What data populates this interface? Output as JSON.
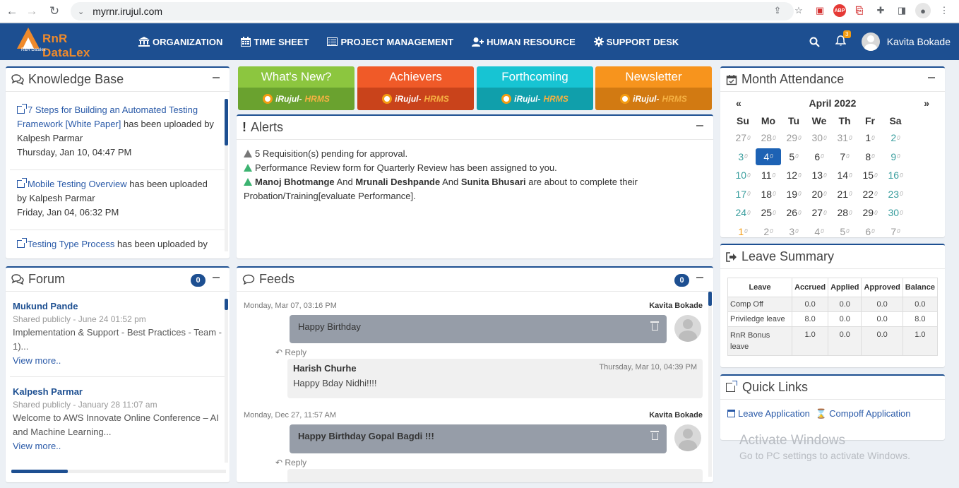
{
  "browser": {
    "url": "myrnr.irujul.com"
  },
  "header": {
    "brand": "RnR DataLex",
    "brand_sub": "R&R Datalex",
    "menu": [
      "ORGANIZATION",
      "TIME SHEET",
      "PROJECT MANAGEMENT",
      "HUMAN RESOURCE",
      "SUPPORT DESK"
    ],
    "notification_count": "3",
    "user_name": "Kavita Bokade"
  },
  "knowledge_base": {
    "title": "Knowledge Base",
    "items": [
      {
        "link": "7 Steps for Building an Automated Testing Framework [White Paper]",
        "text": " has been uploaded by Kalpesh Parmar",
        "date": "Thursday, Jan 10, 04:47 PM"
      },
      {
        "link": "Mobile Testing Overview",
        "text": " has been uploaded by Kalpesh Parmar",
        "date": "Friday, Jan 04, 06:32 PM"
      },
      {
        "link": "Testing Type Process",
        "text": " has been uploaded by",
        "date": ""
      }
    ]
  },
  "tiles": [
    {
      "label": "What's New?",
      "brand": "iRujul-",
      "brand2": "HRMS",
      "top": "#8cc63f",
      "bottom": "#6aa22f"
    },
    {
      "label": "Achievers",
      "brand": "iRujul-",
      "brand2": "HRMS",
      "top": "#f05a28",
      "bottom": "#c9431b"
    },
    {
      "label": "Forthcoming",
      "brand": "iRujul-",
      "brand2": "HRMS",
      "top": "#17c4d3",
      "bottom": "#109fab"
    },
    {
      "label": "Newsletter",
      "brand": "iRujul-",
      "brand2": "HRMS",
      "top": "#f7941d",
      "bottom": "#d27a12"
    }
  ],
  "alerts": {
    "title": "Alerts",
    "line1": "5 Requisition(s) pending for approval.",
    "line2": "Performance Review form for Quarterly Review has been assigned to you.",
    "line3": {
      "name1": "Manoj Bhotmange",
      "and1": " And ",
      "name2": "Mrunali Deshpande",
      "and2": " And ",
      "name3": "Sunita Bhusari",
      "rest": " are about to complete their Probation/Training[evaluate Performance]."
    }
  },
  "forum": {
    "title": "Forum",
    "count": "0",
    "posts": [
      {
        "author": "Mukund Pande",
        "meta": "Shared publicly - June 24 01:52 pm",
        "text": "Implementation & Support - Best Practices - Team - 1)...",
        "more": "View more.."
      },
      {
        "author": "Kalpesh Parmar",
        "meta": "Shared publicly - January 28 11:07 am",
        "text": "Welcome to AWS Innovate Online Conference – AI and Machine Learning...",
        "more": "View more.."
      }
    ]
  },
  "feeds": {
    "title": "Feeds",
    "count": "0",
    "posts": [
      {
        "date": "Monday, Mar 07, 03:16 PM",
        "author": "Kavita Bokade",
        "message": "Happy Birthday",
        "reply_label": "Reply",
        "reply": {
          "author": "Harish Churhe",
          "date": "Thursday, Mar 10, 04:39 PM",
          "text": "Happy Bday Nidhi!!!!"
        }
      },
      {
        "date": "Monday, Dec 27, 11:57 AM",
        "author": "Kavita Bokade",
        "message": "Happy Birthday Gopal Bagdi !!!",
        "reply_label": "Reply"
      }
    ]
  },
  "attendance": {
    "title": "Month Attendance",
    "month": "April 2022",
    "prev": "«",
    "next": "»",
    "days_of_week": [
      "Su",
      "Mo",
      "Tu",
      "We",
      "Th",
      "Fr",
      "Sa"
    ],
    "weeks": [
      [
        "27",
        "28",
        "29",
        "30",
        "31",
        "1",
        "2"
      ],
      [
        "3",
        "4",
        "5",
        "6",
        "7",
        "8",
        "9"
      ],
      [
        "10",
        "11",
        "12",
        "13",
        "14",
        "15",
        "16"
      ],
      [
        "17",
        "18",
        "19",
        "20",
        "21",
        "22",
        "23"
      ],
      [
        "24",
        "25",
        "26",
        "27",
        "28",
        "29",
        "30"
      ],
      [
        "1",
        "2",
        "3",
        "4",
        "5",
        "6",
        "7"
      ]
    ],
    "sub_mark": "0",
    "today": "4"
  },
  "leave_summary": {
    "title": "Leave Summary",
    "columns": [
      "Leave",
      "Accrued",
      "Applied",
      "Approved",
      "Balance"
    ],
    "rows": [
      [
        "Comp Off",
        "0.0",
        "0.0",
        "0.0",
        "0.0"
      ],
      [
        "Priviledge leave",
        "8.0",
        "0.0",
        "0.0",
        "8.0"
      ],
      [
        "RnR Bonus leave",
        "1.0",
        "0.0",
        "0.0",
        "1.0"
      ]
    ]
  },
  "quick_links": {
    "title": "Quick Links",
    "links": [
      "Leave Application",
      "Compoff Application"
    ]
  },
  "watermark": {
    "line1": "Activate Windows",
    "line2": "Go to PC settings to activate Windows."
  }
}
